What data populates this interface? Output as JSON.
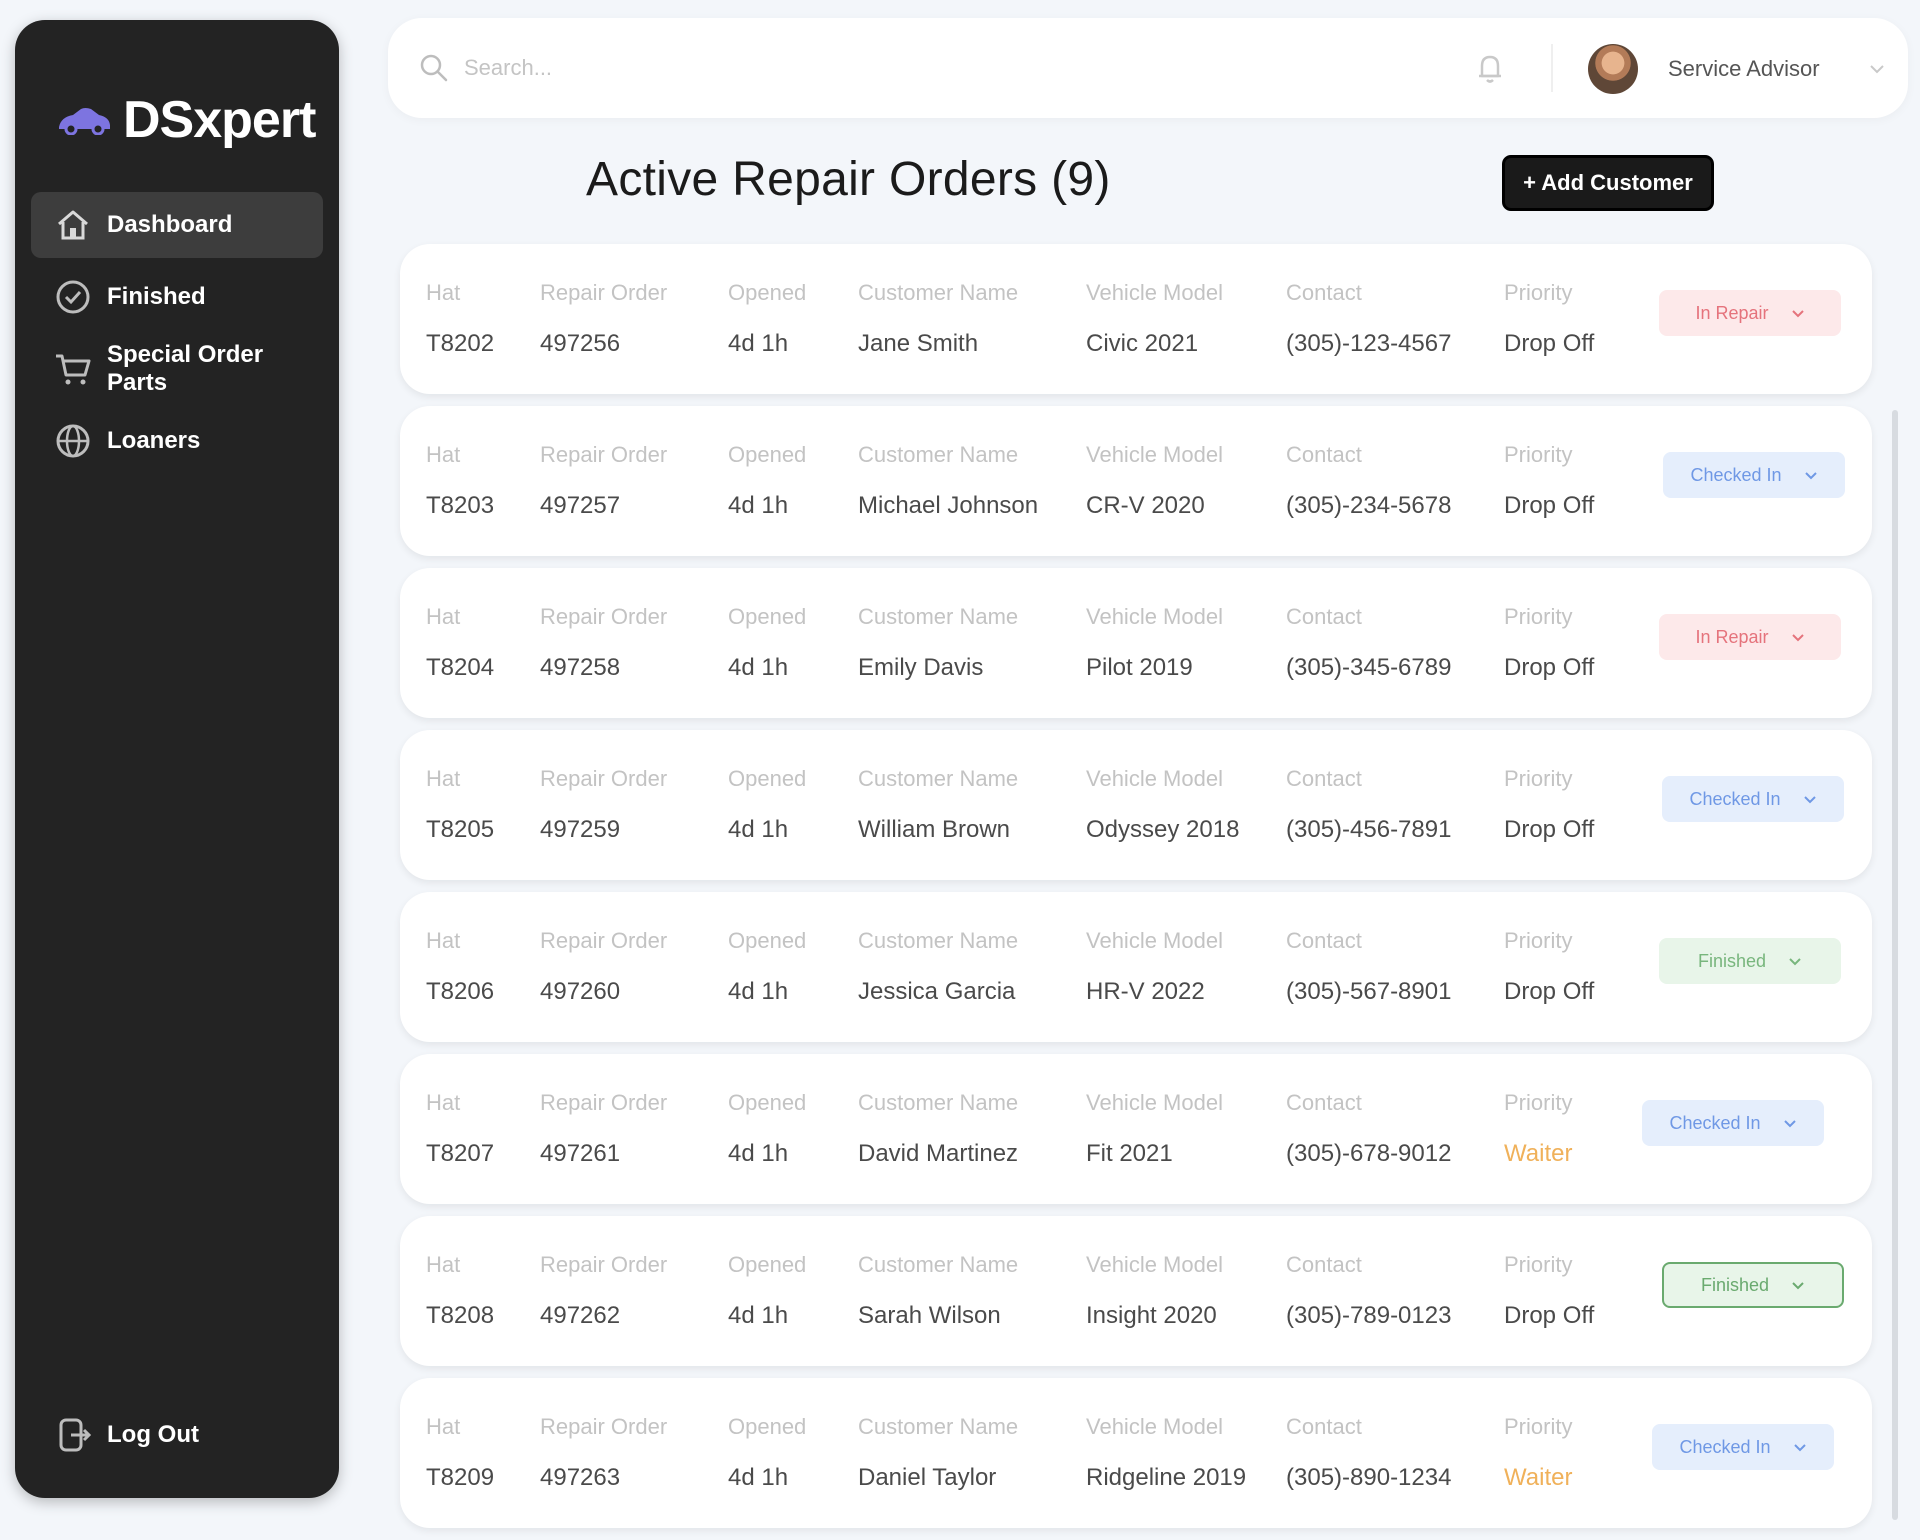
{
  "app": {
    "name": "DSxpert"
  },
  "sidebar": {
    "items": [
      {
        "label": "Dashboard",
        "icon": "home-icon",
        "active": true
      },
      {
        "label": "Finished",
        "icon": "check-circle-icon",
        "active": false
      },
      {
        "label": "Special Order Parts",
        "icon": "cart-icon",
        "active": false
      },
      {
        "label": "Loaners",
        "icon": "globe-icon",
        "active": false
      }
    ],
    "logout_label": "Log Out"
  },
  "topbar": {
    "search_placeholder": "Search...",
    "user_role": "Service Advisor"
  },
  "main": {
    "title": "Active Repair Orders (9)",
    "add_button_label": "+ Add Customer"
  },
  "columns": {
    "hat": "Hat",
    "repair_order": "Repair Order",
    "opened": "Opened",
    "customer_name": "Customer Name",
    "vehicle_model": "Vehicle Model",
    "contact": "Contact",
    "priority": "Priority"
  },
  "orders": [
    {
      "hat": "T8202",
      "repair_order": "497256",
      "opened": "4d 1h",
      "customer_name": "Jane Smith",
      "vehicle_model": "Civic 2021",
      "contact": "(305)-123-4567",
      "priority": "Drop Off",
      "status": "In Repair",
      "status_style": "repair"
    },
    {
      "hat": "T8203",
      "repair_order": "497257",
      "opened": "4d 1h",
      "customer_name": "Michael Johnson",
      "vehicle_model": "CR-V 2020",
      "contact": "(305)-234-5678",
      "priority": "Drop Off",
      "status": "Checked In",
      "status_style": "checked"
    },
    {
      "hat": "T8204",
      "repair_order": "497258",
      "opened": "4d 1h",
      "customer_name": "Emily Davis",
      "vehicle_model": "Pilot 2019",
      "contact": "(305)-345-6789",
      "priority": "Drop Off",
      "status": "In Repair",
      "status_style": "repair"
    },
    {
      "hat": "T8205",
      "repair_order": "497259",
      "opened": "4d 1h",
      "customer_name": "William Brown",
      "vehicle_model": "Odyssey 2018",
      "contact": "(305)-456-7891",
      "priority": "Drop Off",
      "status": "Checked In",
      "status_style": "checked"
    },
    {
      "hat": "T8206",
      "repair_order": "497260",
      "opened": "4d 1h",
      "customer_name": "Jessica Garcia",
      "vehicle_model": "HR-V 2022",
      "contact": "(305)-567-8901",
      "priority": "Drop Off",
      "status": "Finished",
      "status_style": "finished"
    },
    {
      "hat": "T8207",
      "repair_order": "497261",
      "opened": "4d 1h",
      "customer_name": "David Martinez",
      "vehicle_model": "Fit 2021",
      "contact": "(305)-678-9012",
      "priority": "Waiter",
      "status": "Checked In",
      "status_style": "checked"
    },
    {
      "hat": "T8208",
      "repair_order": "497262",
      "opened": "4d 1h",
      "customer_name": "Sarah Wilson",
      "vehicle_model": "Insight 2020",
      "contact": "(305)-789-0123",
      "priority": "Drop Off",
      "status": "Finished",
      "status_style": "finished-outline"
    },
    {
      "hat": "T8209",
      "repair_order": "497263",
      "opened": "4d 1h",
      "customer_name": "Daniel Taylor",
      "vehicle_model": "Ridgeline 2019",
      "contact": "(305)-890-1234",
      "priority": "Waiter",
      "status": "Checked In",
      "status_style": "checked"
    }
  ],
  "colors": {
    "sidebar_bg": "#232323",
    "page_bg": "#f3f6fa",
    "waiter": "#f0b15a",
    "in_repair": "#e5737c",
    "checked_in": "#6f98e5",
    "finished": "#78b67d"
  }
}
